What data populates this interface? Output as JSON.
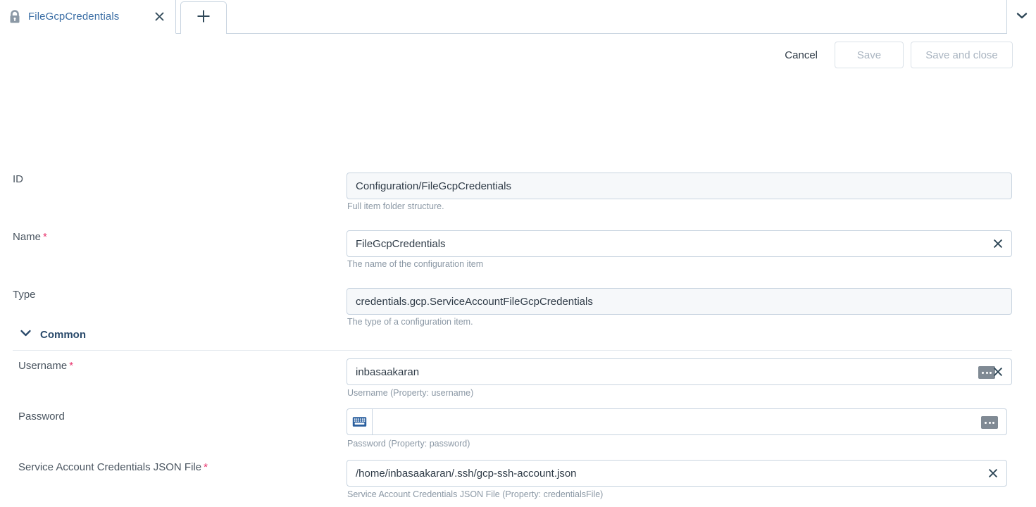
{
  "tabbar": {
    "lock_icon": "lock-icon",
    "tab_title": "FileGcpCredentials",
    "close_icon": "close-icon",
    "new_tab_icon": "plus-icon",
    "tab_menu_icon": "chevron-down-icon"
  },
  "toolbar": {
    "cancel_label": "Cancel",
    "save_label": "Save",
    "save_and_close_label": "Save and close"
  },
  "form": {
    "id": {
      "label": "ID",
      "value": "Configuration/FileGcpCredentials",
      "hint": "Full item folder structure.",
      "readonly": true
    },
    "name": {
      "label": "Name",
      "required": "*",
      "value": "FileGcpCredentials",
      "hint": "The name of the configuration item",
      "clear_icon": "close-icon"
    },
    "type": {
      "label": "Type",
      "value": "credentials.gcp.ServiceAccountFileGcpCredentials",
      "hint": "The type of a configuration item.",
      "readonly": true
    },
    "section_common": {
      "title": "Common",
      "chevron_icon": "chevron-down-icon"
    },
    "username": {
      "label": "Username",
      "required": "*",
      "value": "inbasaakaran",
      "hint": "Username (Property: username)",
      "more_icon": "ellipsis-icon",
      "clear_icon": "close-icon"
    },
    "password": {
      "label": "Password",
      "value": "",
      "placeholder": "",
      "hint": "Password (Property: password)",
      "keyboard_icon": "keyboard-icon",
      "more_icon": "ellipsis-icon"
    },
    "credentials_file": {
      "label": "Service Account Credentials JSON File",
      "required": "*",
      "value": "/home/inbasaakaran/.ssh/gcp-ssh-account.json",
      "hint": "Service Account Credentials JSON File (Property: credentialsFile)",
      "clear_icon": "close-icon"
    }
  },
  "colors": {
    "tab_link": "#3b6ea5",
    "required_star": "#e8336d",
    "section_title": "#2a4a6b",
    "border": "#c8d4e0",
    "hint_text": "#8b98a5",
    "readonly_bg": "#f6f8fa",
    "icon_dark": "#2f4858"
  }
}
